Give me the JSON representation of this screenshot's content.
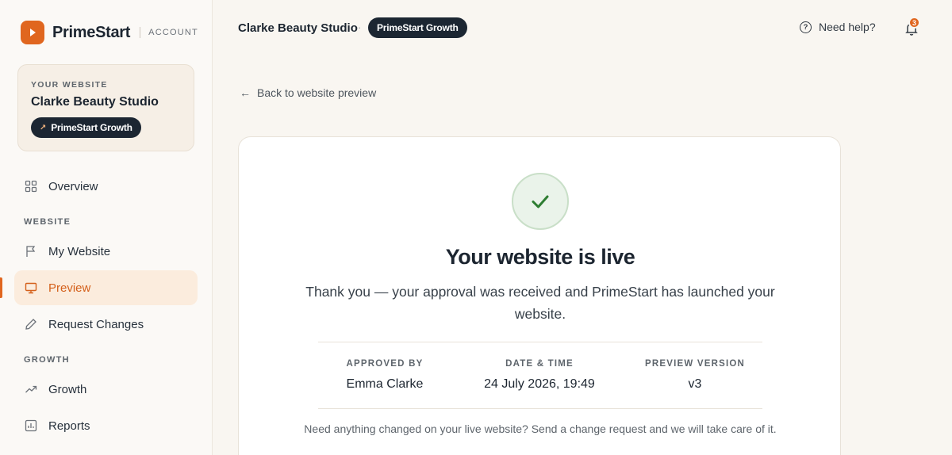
{
  "brand": {
    "name": "PrimeStart",
    "section": "ACCOUNT",
    "logo_icon": "play-icon",
    "accent": "#e0661f"
  },
  "website_card": {
    "label": "YOUR WEBSITE",
    "name": "Clarke Beauty Studio",
    "plan": "PrimeStart Growth"
  },
  "nav": {
    "overview": "Overview",
    "website_section": "WEBSITE",
    "my_website": "My Website",
    "preview": "Preview",
    "request_changes": "Request Changes",
    "growth_section": "GROWTH",
    "growth": "Growth",
    "reports": "Reports",
    "active": "Preview"
  },
  "topbar": {
    "site_name": "Clarke Beauty Studio",
    "separator": "·",
    "plan": "PrimeStart Growth",
    "help_label": "Need help?",
    "notification_count": "3"
  },
  "back_link": "Back to website preview",
  "confirmation": {
    "title": "Your website is live",
    "message": "Thank you — your approval was received and PrimeStart has launched your website.",
    "approved_by_label": "APPROVED BY",
    "approved_by": "Emma Clarke",
    "datetime_label": "DATE & TIME",
    "datetime": "24 July 2026, 19:49",
    "version_label": "PREVIEW VERSION",
    "version": "v3",
    "footnote": "Need anything changed on your live website? Send a change request and we will take care of it.",
    "success_color": "#2e7d32"
  }
}
